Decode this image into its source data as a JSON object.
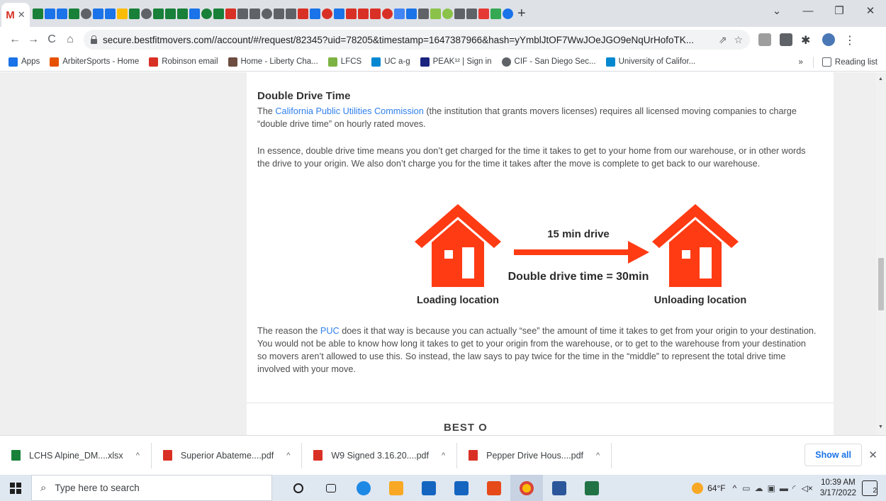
{
  "browser": {
    "url": "secure.bestfitmovers.com//account/#/request/82345?uid=78205&timestamp=1647387966&hash=yYmblJtOF7WwJOeJGO9eNqUrHofoTK...",
    "active_tab_icon": "gmail-icon",
    "favicon_colors": [
      "#188038",
      "#1a73e8",
      "#1a73e8",
      "#188038",
      "#5f6368",
      "#1a73e8",
      "#1a73e8",
      "#fbbc04",
      "#188038",
      "#5f6368",
      "#188038",
      "#188038",
      "#188038",
      "#1a73e8",
      "#188038",
      "#188038",
      "#d93025",
      "#5f6368",
      "#5f6368",
      "#5f6368",
      "#5f6368",
      "#5f6368",
      "#d93025",
      "#1a73e8",
      "#d93025",
      "#1a73e8",
      "#d93025",
      "#d93025",
      "#d93025",
      "#d93025",
      "#4285f4",
      "#1a73e8",
      "#5f6368",
      "#8bc34a",
      "#8bc34a",
      "#5f6368",
      "#5f6368",
      "#e53935",
      "#34a853",
      "#1a73e8"
    ]
  },
  "bookmarks": [
    {
      "label": "Apps",
      "color": "#1a73e8"
    },
    {
      "label": "ArbiterSports - Home",
      "color": "#e65100"
    },
    {
      "label": "Robinson email",
      "color": "#d93025"
    },
    {
      "label": "Home - Liberty Cha...",
      "color": "#6d4c41"
    },
    {
      "label": "LFCS",
      "color": "#7cb342"
    },
    {
      "label": "UC a-g",
      "color": "#0288d1"
    },
    {
      "label": "PEAK¹² | Sign in",
      "color": "#1a237e"
    },
    {
      "label": "CIF - San Diego Sec...",
      "color": "#5f6368"
    },
    {
      "label": "University of Califor...",
      "color": "#0288d1"
    }
  ],
  "bookmarks_more": "»",
  "reading_list": "Reading list",
  "article": {
    "heading": "Double Drive Time",
    "p1_pre": "The ",
    "p1_link": "California Public Utilities Commission",
    "p1_post": " (the institution that grants movers licenses) requires all licensed moving companies to charge “double drive time” on hourly rated moves.",
    "p2": "In essence, double drive time means you don’t get charged for the time it takes to get to your home from our warehouse, or in other words the drive to your origin. We also don’t charge you for the time it takes after the move is complete to get back to our warehouse.",
    "p3_pre": "The reason the ",
    "p3_link": "PUC",
    "p3_post": " does it that way is because you can actually “see” the amount of time it takes to get from your origin to your destination.  You would not be able to know how long it takes to get to your origin from the warehouse, or to get to the warehouse from your destination so movers aren’t allowed to use this.  So instead, the law says to pay twice for the time in the “middle” to represent the total drive time involved with your move.",
    "logo_partial": "BEST O"
  },
  "diagram": {
    "drive_label": "15 min drive",
    "double_label": "Double drive time = 30min",
    "loading_label": "Loading location",
    "unloading_label": "Unloading location",
    "color": "#ff3b14"
  },
  "downloads": [
    {
      "name": "LCHS Alpine_DM....xlsx",
      "color": "#188038"
    },
    {
      "name": "Superior Abateme....pdf",
      "color": "#d93025"
    },
    {
      "name": "W9 Signed 3.16.20....pdf",
      "color": "#d93025"
    },
    {
      "name": "Pepper Drive Hous....pdf",
      "color": "#d93025"
    }
  ],
  "downloads_show_all": "Show all",
  "taskbar": {
    "search_placeholder": "Type here to search",
    "weather": "64°F",
    "time": "10:39 AM",
    "date": "3/17/2022",
    "notifications": "2"
  }
}
